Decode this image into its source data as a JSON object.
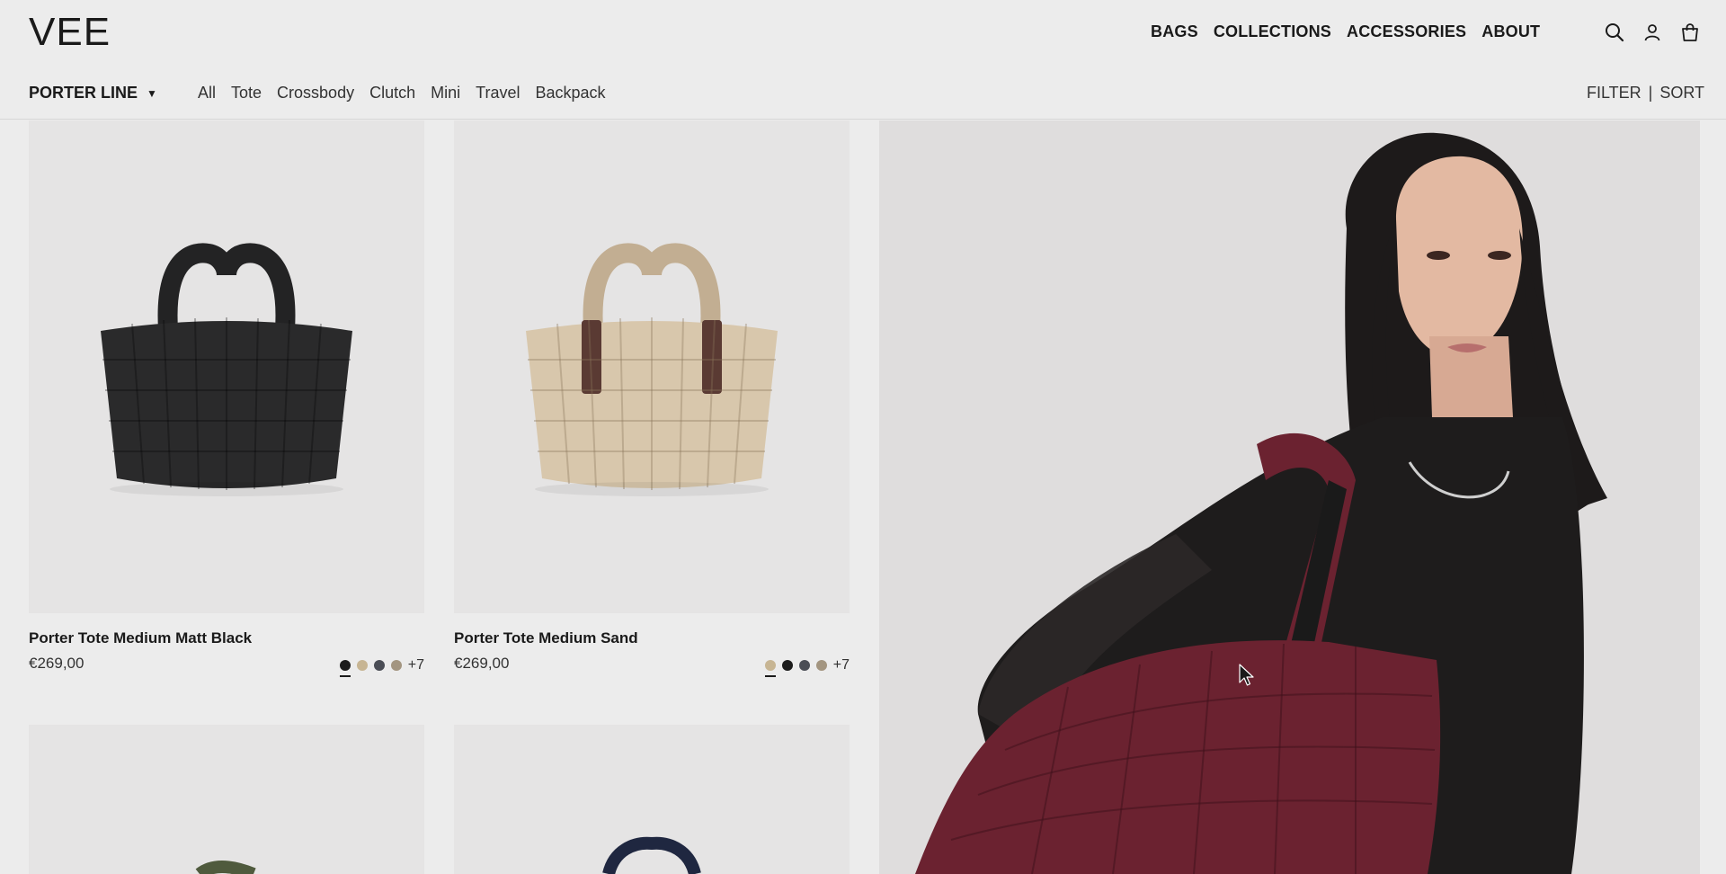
{
  "brand": {
    "logo": "VEE"
  },
  "main_nav": [
    "BAGS",
    "COLLECTIONS",
    "ACCESSORIES",
    "ABOUT"
  ],
  "header_icons": [
    "search-icon",
    "account-icon",
    "bag-icon"
  ],
  "sub_nav": {
    "line": "PORTER LINE",
    "categories": [
      "All",
      "Tote",
      "Crossbody",
      "Clutch",
      "Mini",
      "Travel",
      "Backpack"
    ],
    "filter": "FILTER",
    "separator": "|",
    "sort": "SORT"
  },
  "products": [
    {
      "name": "Porter Tote Medium Matt Black",
      "price": "€269,00",
      "swatches": [
        "#1c1c1c",
        "#c7b593",
        "#4a4d55",
        "#a39580"
      ],
      "more": "+7",
      "bag_color": "#2a2a2b"
    },
    {
      "name": "Porter Tote Medium Sand",
      "price": "€269,00",
      "swatches": [
        "#c7b593",
        "#1c1c1c",
        "#4a4d55",
        "#a39580"
      ],
      "more": "+7",
      "bag_color": "#d8c7ac"
    }
  ],
  "hero": {
    "bag_color": "#6b2230"
  }
}
